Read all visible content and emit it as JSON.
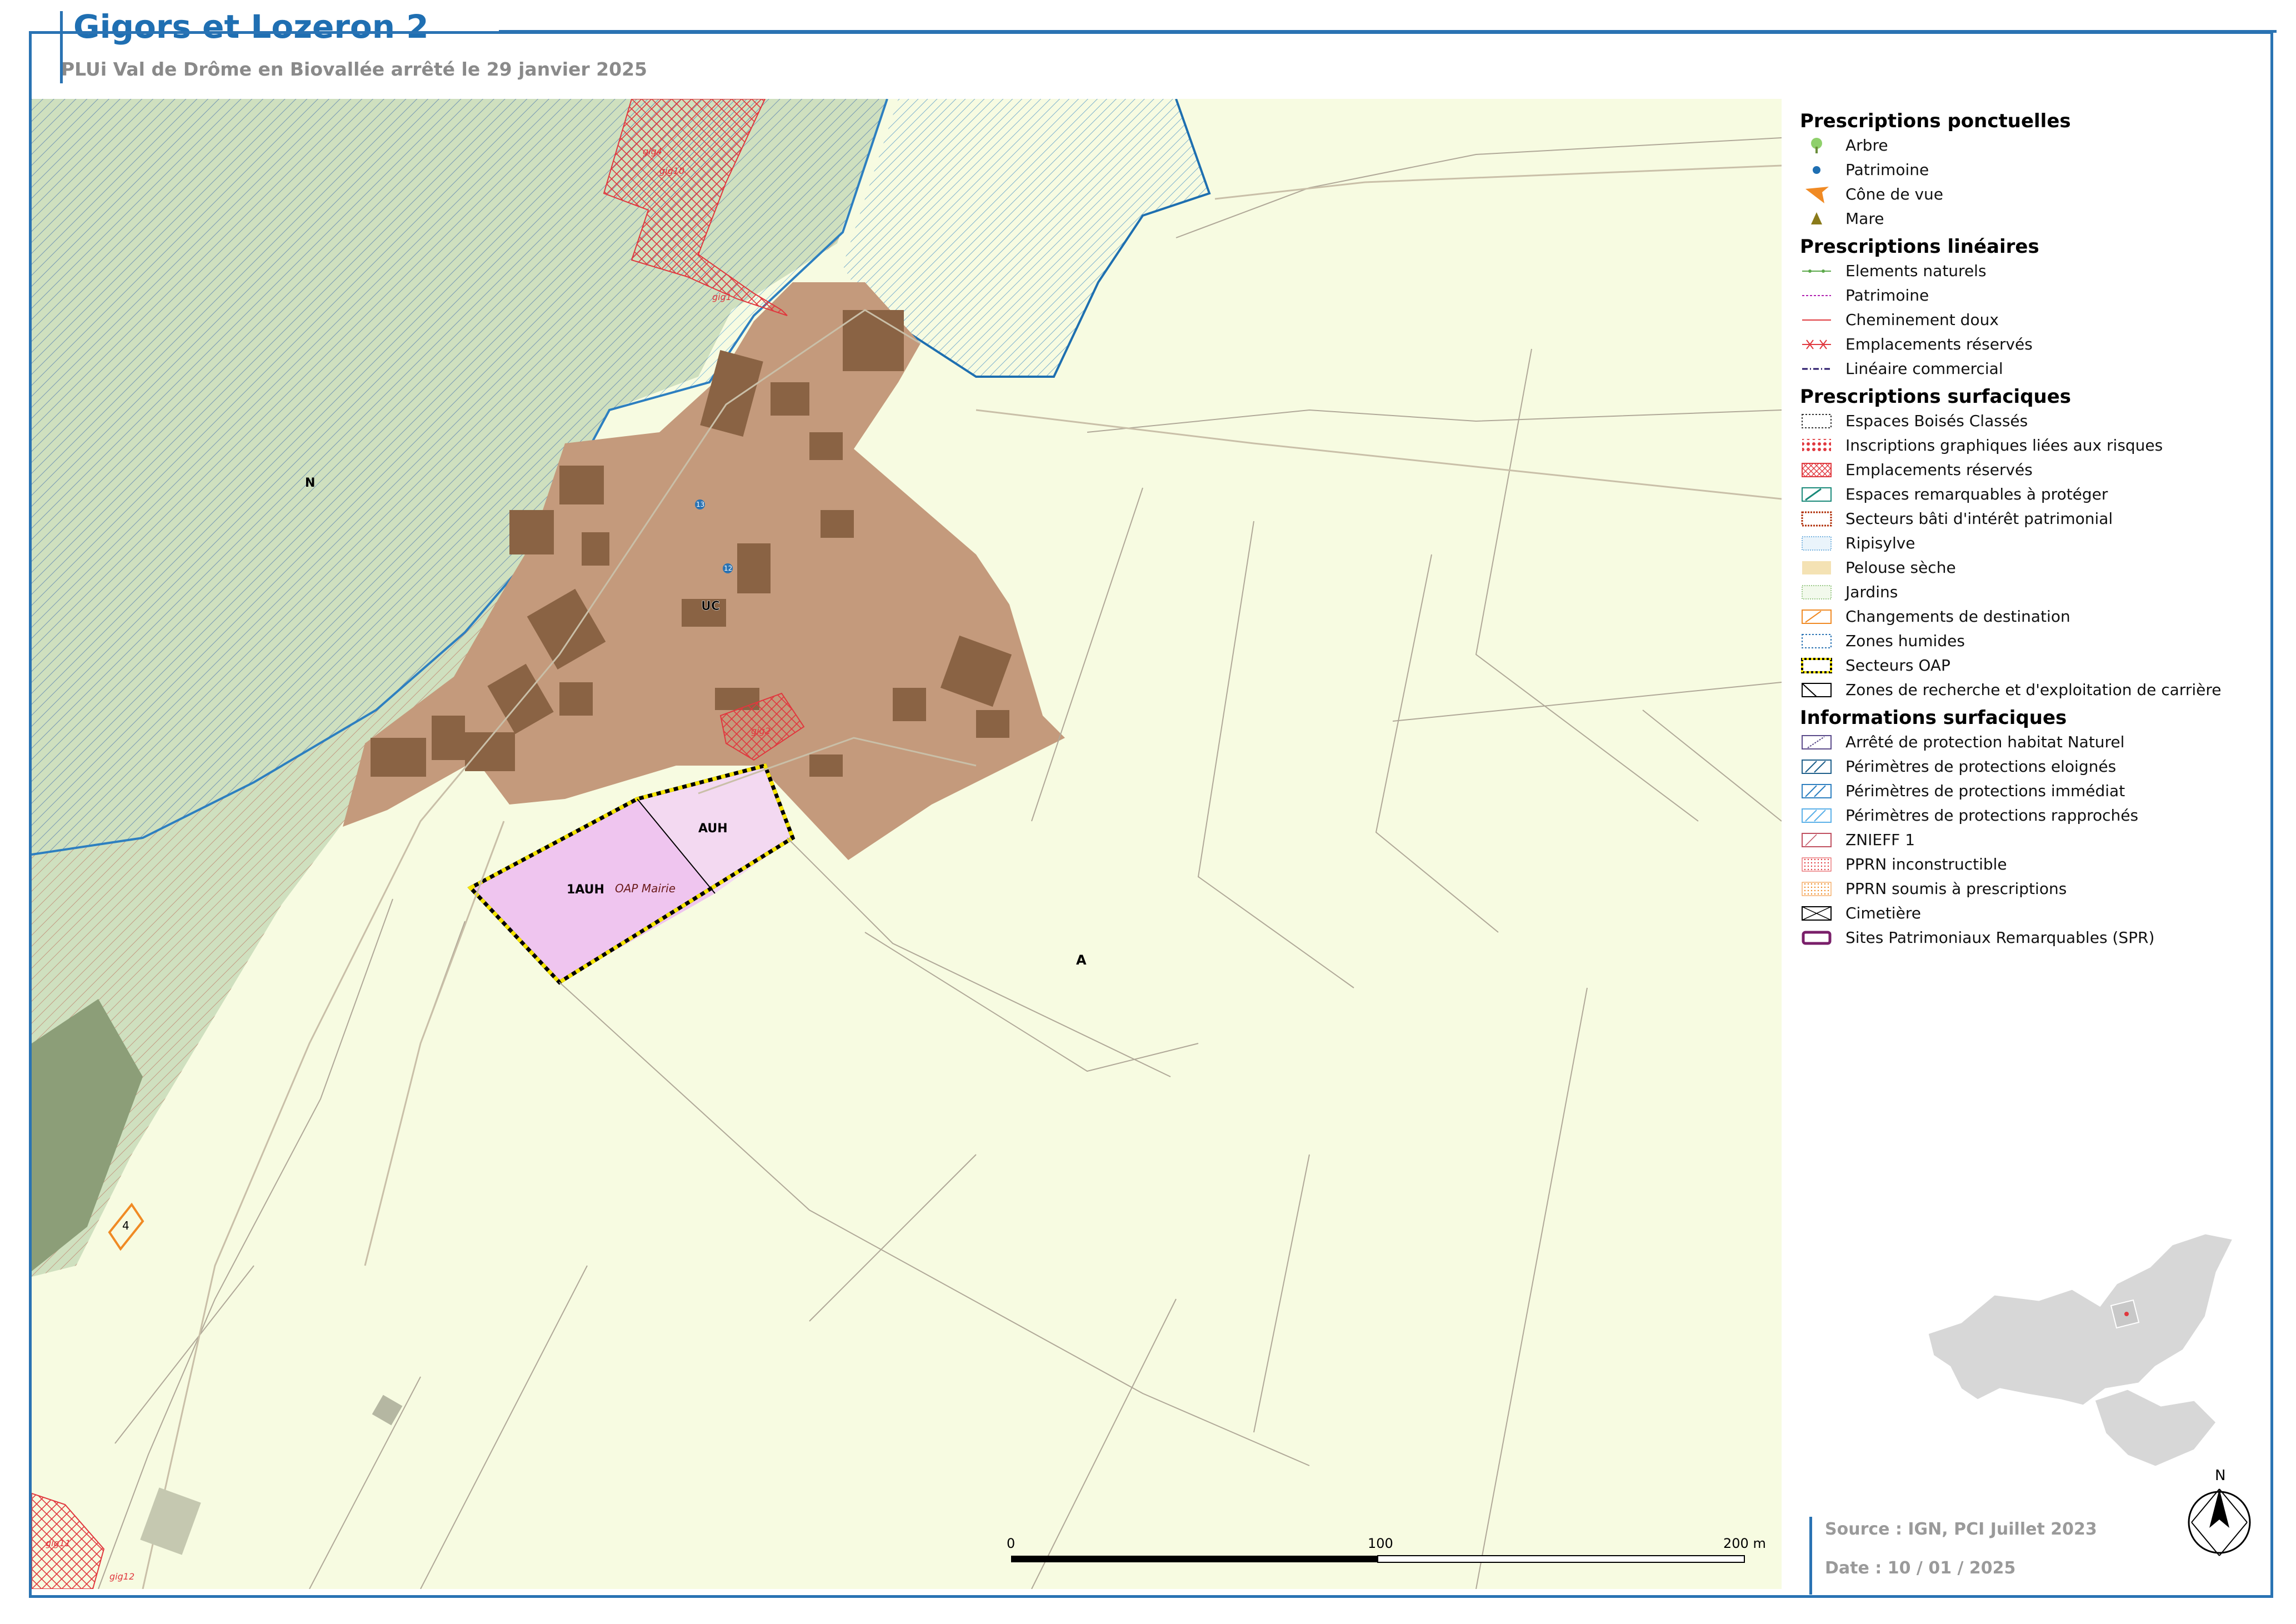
{
  "title": "Gigors et Lozeron 2",
  "subtitle": "PLUi Val de Drôme en Biovallée arrêté le 29 janvier 2025",
  "map": {
    "zone_labels": {
      "N": "N",
      "UC": "UC",
      "AUH": "AUH",
      "AUH1": "1AUH",
      "A": "A",
      "oap": "OAP Mairie"
    },
    "er_labels": {
      "gig4": "gig4",
      "gig10": "gig10",
      "gig1": "gig1",
      "gig2": "gig2",
      "gig11": "gig11",
      "gig12": "gig12"
    },
    "change_dest_label": "4",
    "patrimoine_labels": [
      "13",
      "12"
    ],
    "scale": {
      "t0": "0",
      "t1": "100",
      "t2": "200 m"
    }
  },
  "legend": {
    "ponctuelles": {
      "title": "Prescriptions ponctuelles",
      "items": [
        "Arbre",
        "Patrimoine",
        "Cône de vue",
        "Mare"
      ]
    },
    "lineaires": {
      "title": "Prescriptions linéaires",
      "items": [
        "Elements naturels",
        "Patrimoine",
        "Cheminement doux",
        "Emplacements réservés",
        "Linéaire commercial"
      ]
    },
    "surfaciques": {
      "title": "Prescriptions surfaciques",
      "items": [
        "Espaces Boisés Classés",
        "Inscriptions graphiques liées aux risques",
        "Emplacements réservés",
        "Espaces remarquables à protéger",
        "Secteurs bâti d'intérêt patrimonial",
        "Ripisylve",
        "Pelouse sèche",
        "Jardins",
        "Changements de destination",
        "Zones humides",
        "Secteurs OAP",
        "Zones de recherche et d'exploitation de carrière"
      ]
    },
    "informations": {
      "title": "Informations surfaciques",
      "items": [
        "Arrêté de protection habitat Naturel",
        "Périmètres de protections eloignés",
        "Périmètres de protections immédiat",
        "Périmètres de protections rapprochés",
        "ZNIEFF 1",
        "PPRN inconstructible",
        "PPRN soumis à prescriptions",
        "Cimetière",
        "Sites Patrimoniaux Remarquables (SPR)"
      ]
    }
  },
  "source": "Source : IGN, PCI Juillet 2023",
  "date": "Date : 10 / 01 / 2025",
  "north_label": "N",
  "colors": {
    "frame": "#2a73b3",
    "zone_A": "#f7fbe1",
    "zone_N": "#cfe0bf",
    "zone_UC": "#c49a7c",
    "zone_AUH": "#f3d9f1",
    "zone_1AUH": "#efc5ef",
    "building": "#8a6344",
    "er_red": "#e0383e",
    "oap_yellow": "#f5e400"
  }
}
